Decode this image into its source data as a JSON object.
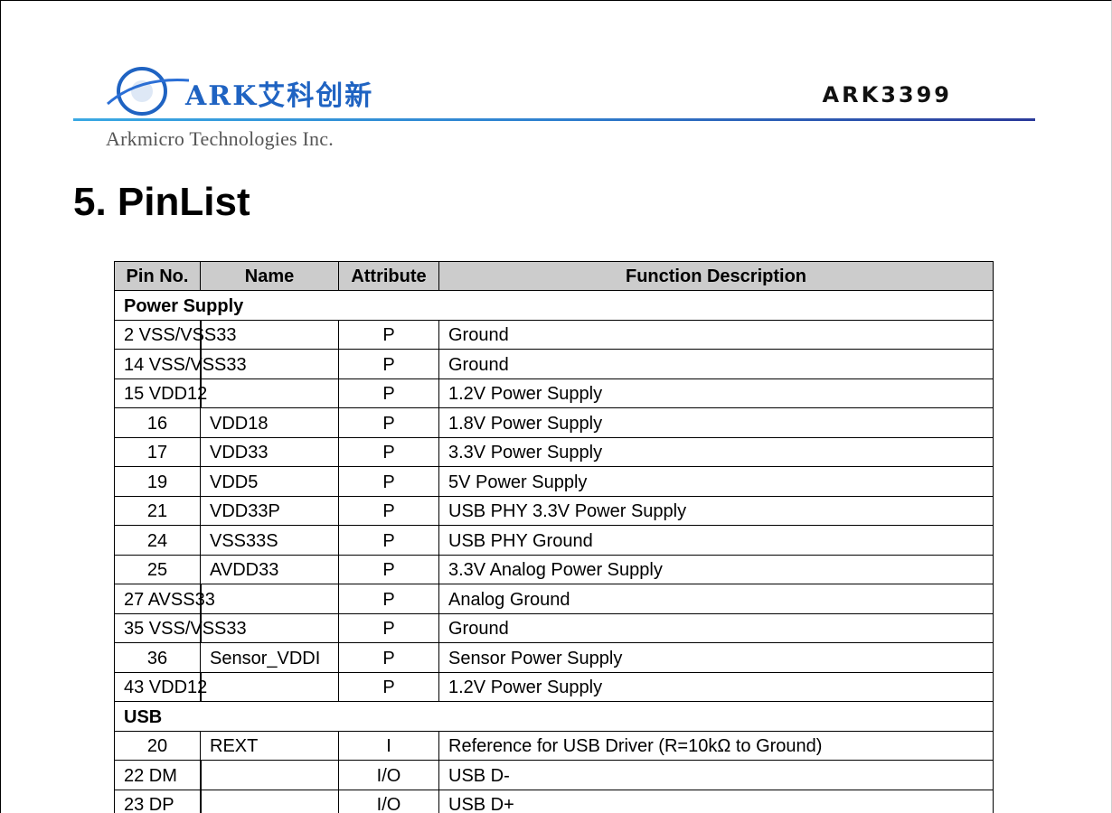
{
  "header": {
    "logo_text": "ARK艾科创新",
    "model": "ARK3399",
    "company": "Arkmicro  Technologies Inc."
  },
  "section_title": "5. PinList",
  "table": {
    "columns": [
      "Pin No.",
      "Name",
      "Attribute",
      "Function Description"
    ],
    "groups": [
      {
        "title": "Power Supply",
        "rows": [
          {
            "type": "merged",
            "cell": "2 VSS/VSS33",
            "attr": "P",
            "desc": "Ground"
          },
          {
            "type": "merged",
            "cell": "14 VSS/VSS33",
            "attr": "P",
            "desc": "Ground"
          },
          {
            "type": "merged",
            "cell": "15 VDD12",
            "attr": "P",
            "desc": "1.2V Power Supply"
          },
          {
            "type": "split",
            "pin": "16",
            "name": "VDD18",
            "attr": "P",
            "desc": "1.8V Power Supply"
          },
          {
            "type": "split",
            "pin": "17",
            "name": "VDD33",
            "attr": "P",
            "desc": "3.3V Power Supply"
          },
          {
            "type": "split",
            "pin": "19",
            "name": "VDD5",
            "attr": "P",
            "desc": "5V Power Supply"
          },
          {
            "type": "split",
            "pin": "21",
            "name": "VDD33P",
            "attr": "P",
            "desc": "USB PHY 3.3V Power Supply"
          },
          {
            "type": "split",
            "pin": "24",
            "name": "VSS33S",
            "attr": "P",
            "desc": "USB PHY Ground"
          },
          {
            "type": "split",
            "pin": "25",
            "name": "AVDD33",
            "attr": "P",
            "desc": "3.3V Analog Power Supply"
          },
          {
            "type": "merged",
            "cell": "27 AVSS33",
            "attr": "P",
            "desc": "Analog Ground"
          },
          {
            "type": "merged",
            "cell": "35 VSS/VSS33",
            "attr": "P",
            "desc": "Ground"
          },
          {
            "type": "split",
            "pin": "36",
            "name": "Sensor_VDDI",
            "attr": "P",
            "desc": "Sensor Power Supply"
          },
          {
            "type": "merged",
            "cell": "43 VDD12",
            "attr": "P",
            "desc": "1.2V Power Supply"
          }
        ]
      },
      {
        "title": "USB",
        "rows": [
          {
            "type": "split",
            "pin": "20",
            "name": "REXT",
            "attr": "I",
            "desc": "Reference for USB Driver (R=10kΩ to Ground)"
          },
          {
            "type": "merged",
            "cell": "22 DM",
            "attr": "I/O",
            "desc": "USB D-"
          },
          {
            "type": "merged",
            "cell": "23 DP",
            "attr": "I/O",
            "desc": "USB D+"
          }
        ]
      }
    ]
  }
}
